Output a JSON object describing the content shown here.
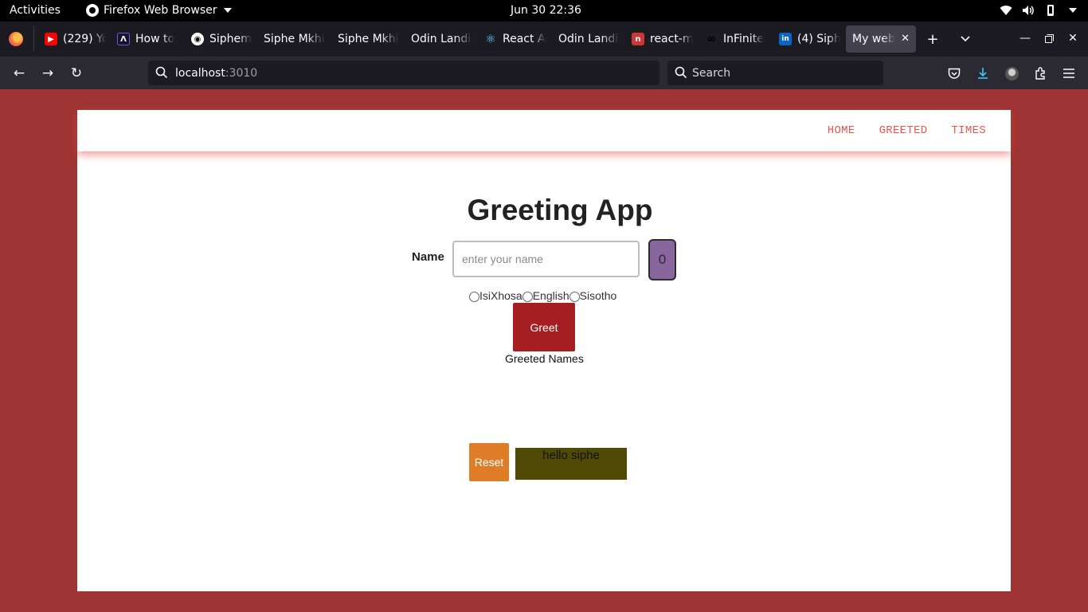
{
  "os_bar": {
    "activities": "Activities",
    "app_name": "Firefox Web Browser",
    "datetime": "Jun 30  22:36"
  },
  "browser": {
    "tabs": [
      {
        "label": "(229) YouTube",
        "favicon": "youtube-icon",
        "color": "#ff0000"
      },
      {
        "label": "How to",
        "favicon": "astro-icon",
        "color": "#1c1b22"
      },
      {
        "label": "Siphem",
        "favicon": "github-icon",
        "color": "#1c1b22"
      },
      {
        "label": "Siphe Mkhize",
        "favicon": "none",
        "color": "#1c1b22"
      },
      {
        "label": "Siphe Mkhize",
        "favicon": "none",
        "color": "#1c1b22"
      },
      {
        "label": "Odin Landing",
        "favicon": "none",
        "color": "#1c1b22"
      },
      {
        "label": "React App",
        "favicon": "react-icon",
        "color": "#61dafb"
      },
      {
        "label": "Odin Landing",
        "favicon": "none",
        "color": "#1c1b22"
      },
      {
        "label": "react-m",
        "favicon": "npm-icon",
        "color": "#cb3837"
      },
      {
        "label": "InFinite",
        "favicon": "infinity-icon",
        "color": "#1c1b22"
      },
      {
        "label": "(4) Siphe",
        "favicon": "linkedin-icon",
        "color": "#0a66c2"
      },
      {
        "label": "My web",
        "favicon": "none",
        "color": "#42414d",
        "active": true
      }
    ],
    "url_host": "localhost",
    "url_port": ":3010",
    "search_placeholder": "Search"
  },
  "site": {
    "nav": [
      "HOME",
      "GREETED",
      "TIMES"
    ],
    "title": "Greeting App",
    "name_label": "Name",
    "name_placeholder": "enter your name",
    "counter": "0",
    "languages": [
      "IsiXhosa",
      "English",
      "Sisotho"
    ],
    "greet_label": "Greet",
    "greeted_names_label": "Greeted Names",
    "reset_label": "Reset",
    "message": "hello siphe",
    "colors": {
      "background": "#9e3433",
      "nav_link": "#e2584f",
      "counter": "#8a669e",
      "greet": "#a51e22",
      "reset": "#df7c27",
      "message_bg": "#4f4b07"
    }
  }
}
